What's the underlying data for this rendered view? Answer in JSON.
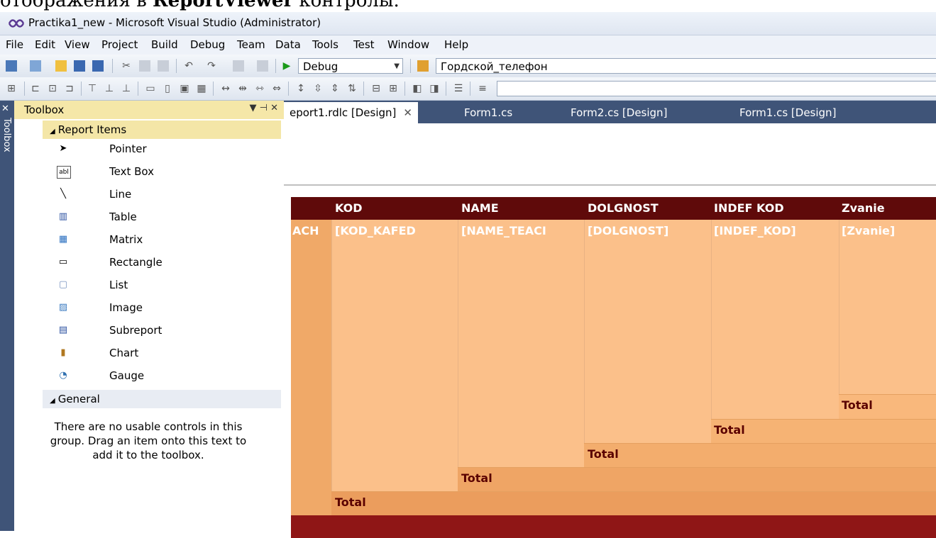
{
  "doc_text": {
    "before": "отображения в ",
    "bold": "ReportViewer",
    "after": " контролы."
  },
  "window": {
    "title": "Practika1_new - Microsoft Visual Studio (Administrator)"
  },
  "menu": [
    "File",
    "Edit",
    "View",
    "Project",
    "Build",
    "Debug",
    "Team",
    "Data",
    "Tools",
    "Test",
    "Window",
    "Help"
  ],
  "toolbar": {
    "config_value": "Debug",
    "project_value": "Гордской_телефон"
  },
  "toolbox": {
    "strip_label": "Toolbox",
    "title": "Toolbox",
    "groups": {
      "report_items": "Report Items",
      "general": "General"
    },
    "items": [
      "Pointer",
      "Text Box",
      "Line",
      "Table",
      "Matrix",
      "Rectangle",
      "List",
      "Image",
      "Subreport",
      "Chart",
      "Gauge"
    ],
    "empty_message": "There are no usable controls in this group. Drag an item onto this text to add it to the toolbox."
  },
  "tabs": [
    "eport1.rdlc [Design]",
    "Form1.cs",
    "Form2.cs [Design]",
    "Form1.cs [Design]"
  ],
  "report": {
    "headers": [
      "KOD",
      "NAME",
      "DOLGNOST",
      "INDEF KOD",
      "Zvanie"
    ],
    "left_cell": "ACH",
    "fields": [
      "[KOD_KAFED",
      "[NAME_TEACI",
      "[DOLGNOST]",
      "[INDEF_KOD]",
      "[Zvanie]"
    ],
    "total": "Total"
  }
}
